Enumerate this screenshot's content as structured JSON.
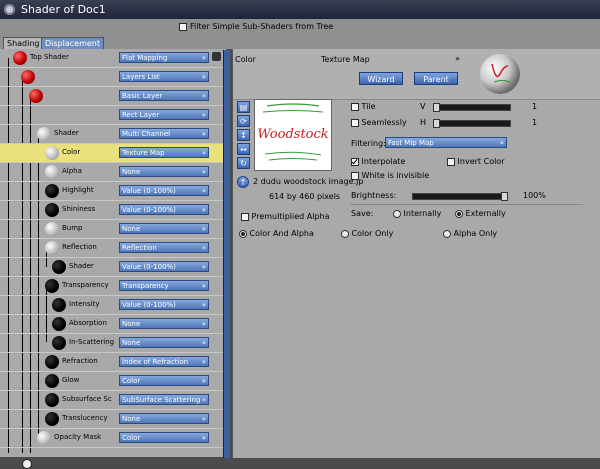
{
  "window": {
    "title": "Shader of Doc1"
  },
  "topbar": {
    "filter_label": "Filter Simple Sub-Shaders from Tree",
    "filter_checked": false
  },
  "tabs": [
    {
      "label": "Shading"
    },
    {
      "label": "Displacement"
    }
  ],
  "tree": {
    "rows": [
      {
        "label": "Top Shader",
        "value": "Flat Mapping"
      },
      {
        "label": "",
        "value": "Layers List"
      },
      {
        "label": "",
        "value": "Basic Layer"
      },
      {
        "label": "",
        "value": "Rect Layer"
      },
      {
        "label": "Shader",
        "value": "Multi Channel"
      },
      {
        "label": "Color",
        "value": "Texture Map"
      },
      {
        "label": "Alpha",
        "value": "None"
      },
      {
        "label": "Highlight",
        "value": "Value (0-100%)"
      },
      {
        "label": "Shininess",
        "value": "Value (0-100%)"
      },
      {
        "label": "Bump",
        "value": "None"
      },
      {
        "label": "Reflection",
        "value": "Reflection"
      },
      {
        "label": "Shader",
        "value": "Value (0-100%)"
      },
      {
        "label": "Transparency",
        "value": "Transparency"
      },
      {
        "label": "Intensity",
        "value": "Value (0-100%)"
      },
      {
        "label": "Absorption",
        "value": "None"
      },
      {
        "label": "In-Scattering",
        "value": "None"
      },
      {
        "label": "Refraction",
        "value": "Index of Refraction"
      },
      {
        "label": "Glow",
        "value": "Color"
      },
      {
        "label": "Subsurface Sc",
        "value": "SubSurface Scattering"
      },
      {
        "label": "Translucency",
        "value": "None"
      },
      {
        "label": "Opacity Mask",
        "value": "Color"
      }
    ]
  },
  "editor": {
    "channel_label": "Color",
    "type_label": "Texture Map",
    "wizard_button": "Wizard",
    "parent_button": "Parent",
    "preview_text": "Woodstock",
    "filename": "2 dudu woodstock image.jp",
    "dimensions": "614 by 460 pixels",
    "tile_label": "Tile",
    "seamlessly_label": "Seamlessly",
    "v_label": "V",
    "h_label": "H",
    "v_value": "1",
    "h_value": "1",
    "filtering_label": "Filtering:",
    "filtering_value": "Fast Mip Map",
    "interpolate_label": "Interpolate",
    "invert_color_label": "Invert Color",
    "white_invisible_label": "White is invisible",
    "brightness_label": "Brightness:",
    "brightness_value": "100%",
    "save_label": "Save:",
    "internally_label": "Internally",
    "externally_label": "Externally",
    "premultiplied_label": "Premultiplied Alpha",
    "color_alpha_label": "Color And Alpha",
    "color_only_label": "Color Only",
    "alpha_only_label": "Alpha Only"
  },
  "colors": {
    "accent_blue": "#4f77b8",
    "highlight_row": "#eae07c",
    "panel_gray": "#a9a9a9"
  }
}
